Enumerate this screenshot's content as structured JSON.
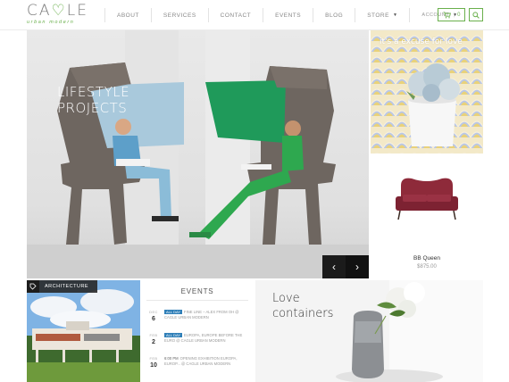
{
  "brand": {
    "name_left": "CA",
    "name_heart": "♡",
    "name_right": "LE",
    "tagline": "urban modern"
  },
  "nav": {
    "items": [
      "ABOUT",
      "SERVICES",
      "CONTACT",
      "EVENTS",
      "BLOG",
      "STORE",
      "ACCOUNT"
    ]
  },
  "cart": {
    "count": "0"
  },
  "hero": {
    "title_line1": "LIFESTYLE",
    "title_line2": "PROJECTS"
  },
  "promo": {
    "text": "it's a excuse for love"
  },
  "product": {
    "name": "BB Queen",
    "price": "$875.00"
  },
  "architecture": {
    "tag": "ARCHITECTURE"
  },
  "events": {
    "title": "EVENTS",
    "items": [
      {
        "month": "DEC",
        "day": "6",
        "badge": "ALL DAY",
        "time": "",
        "text": "FINE LINE – ALEX FROM OH @ CAGLE URBAN MODERN"
      },
      {
        "month": "FEB",
        "day": "2",
        "badge": "ALL DAY",
        "time": "",
        "text": "EUROPA, EUROPE BEFORE THE EURO @ CAGLE URBAN MODERN"
      },
      {
        "month": "FEB",
        "day": "10",
        "badge": "",
        "time": "6:00 PM",
        "text": "OPENING EXHIBITION EUROPA, EUROP... @ CAGLE URBAN MODERN"
      }
    ]
  },
  "love": {
    "title_line1": "Love",
    "title_line2": "containers"
  },
  "colors": {
    "accent": "#6ab04c",
    "badge": "#2f7fb8"
  }
}
